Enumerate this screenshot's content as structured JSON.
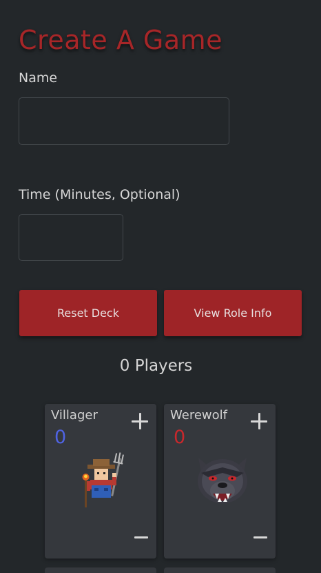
{
  "form": {
    "title": "Create A Game",
    "name_label": "Name",
    "name_value": "",
    "time_label": "Time (Minutes, Optional)",
    "time_value": ""
  },
  "actions": {
    "reset_label": "Reset Deck",
    "info_label": "View Role Info"
  },
  "deck": {
    "players_text": "0 Players",
    "roles": [
      {
        "name": "Villager",
        "count": "0",
        "count_color": "#4f63e3",
        "icon": "villager-farmer-icon"
      },
      {
        "name": "Werewolf",
        "count": "0",
        "count_color": "#c8282c",
        "icon": "werewolf-head-icon"
      }
    ]
  },
  "colors": {
    "accent": "#a72628",
    "button_bg": "#9e2427",
    "background": "#23272a",
    "card_bg": "#35383d"
  }
}
